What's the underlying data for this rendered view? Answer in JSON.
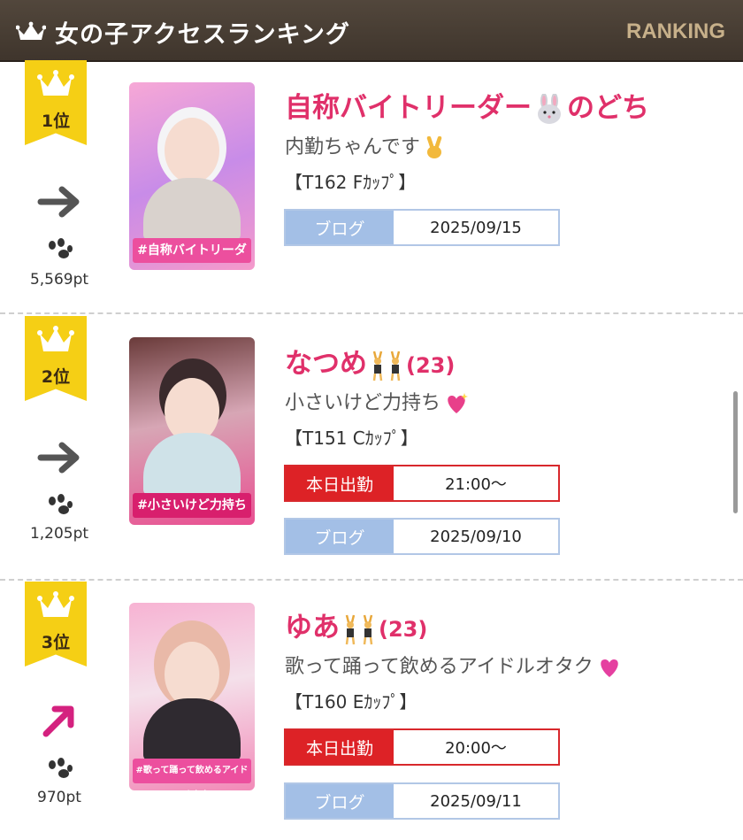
{
  "header": {
    "title": "女の子アクセスランキング",
    "ranking_label": "RANKING"
  },
  "entries": [
    {
      "rank": "1位",
      "trend": "flat",
      "points": "5,569pt",
      "photo_tag": "#自称バイトリーダー",
      "name": "自称バイトリーダー",
      "name_emoji": "rabbit-face-icon",
      "name_suffix": "のどち",
      "age": "",
      "catch": "内勤ちゃんです",
      "catch_emoji": "victory-hand-icon",
      "size": "【T162 Fｶｯﾌﾟ】",
      "today_label": "",
      "today_value": "",
      "blog_label": "ブログ",
      "blog_date": "2025/09/15"
    },
    {
      "rank": "2位",
      "trend": "flat",
      "points": "1,205pt",
      "photo_tag": "#小さいけど力持ち",
      "name": "なつめ",
      "name_emoji": "bunny-dancers-icon",
      "name_suffix": "",
      "age": "(23)",
      "catch": "小さいけど力持ち",
      "catch_emoji": "sparkling-heart-icon",
      "size": "【T151 Cｶｯﾌﾟ】",
      "today_label": "本日出勤",
      "today_value": "21:00〜",
      "blog_label": "ブログ",
      "blog_date": "2025/09/10"
    },
    {
      "rank": "3位",
      "trend": "up",
      "points": "970pt",
      "photo_tag": "#歌って踊って飲めるアイドルオタク",
      "name": "ゆあ",
      "name_emoji": "bunny-dancers-icon",
      "name_suffix": "",
      "age": "(23)",
      "catch": "歌って踊って飲めるアイドルオタク",
      "catch_emoji": "pink-heart-icon",
      "size": "【T160 Eｶｯﾌﾟ】",
      "today_label": "本日出勤",
      "today_value": "20:00〜",
      "blog_label": "ブログ",
      "blog_date": "2025/09/11"
    }
  ],
  "colors": {
    "header_bg": "#4a3f35",
    "name": "#e0306a",
    "badge": "#f5cf15",
    "blog": "#a3bfe6",
    "work": "#dd2226",
    "trend_up": "#d4217f",
    "trend_flat": "#555555"
  }
}
